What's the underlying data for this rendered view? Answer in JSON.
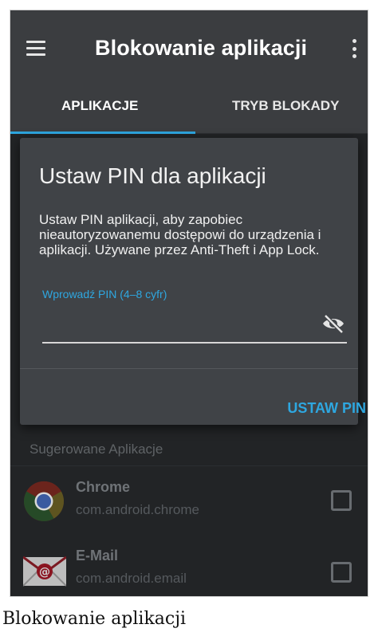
{
  "toolbar": {
    "title": "Blokowanie aplikacji",
    "menu_icon": "hamburger-icon",
    "overflow_icon": "more-vert-icon"
  },
  "tabs": [
    {
      "label": "APLIKACJE",
      "selected": true
    },
    {
      "label": "TRYB BLOKADY",
      "selected": false
    }
  ],
  "dialog": {
    "title": "Ustaw PIN dla aplikacji",
    "message": "Ustaw PIN aplikacji, aby zapobiec nieautoryzowanemu dostępowi do urządzenia i aplikacji. Używane przez Anti-Theft i App Lock.",
    "hint": "Wprowadź PIN (4–8 cyfr)",
    "pin_value": "",
    "visibility_icon": "eye-off-icon",
    "button": "USTAW PIN"
  },
  "suggested": {
    "title": "Sugerowane Aplikacje",
    "apps": [
      {
        "name": "Chrome",
        "package": "com.android.chrome",
        "icon": "chrome-icon",
        "checked": false
      },
      {
        "name": "E-Mail",
        "package": "com.android.email",
        "icon": "email-icon",
        "checked": false
      }
    ]
  },
  "caption": "Blokowanie aplikacji",
  "colors": {
    "accent": "#2ea7e0",
    "toolbar": "#3b3d40",
    "dialog": "#404347",
    "background": "#222426"
  }
}
